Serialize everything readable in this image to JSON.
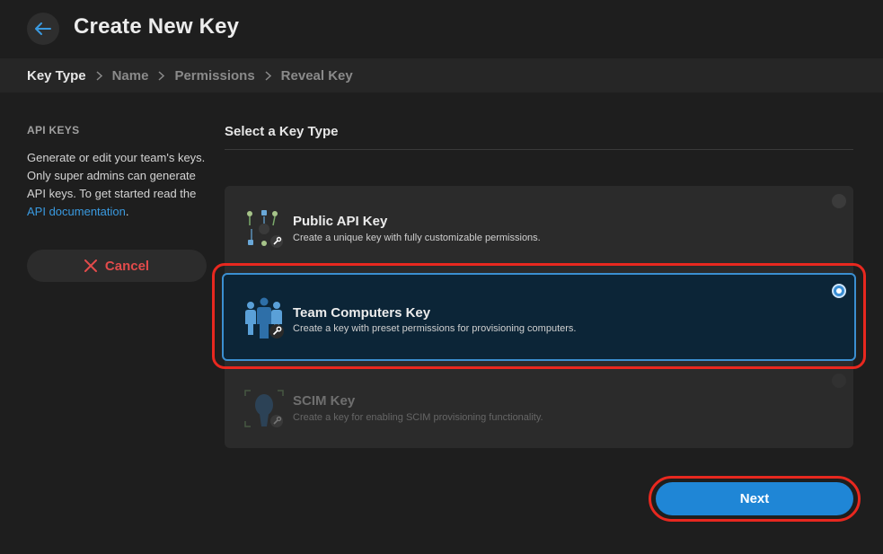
{
  "header": {
    "title": "Create New Key",
    "back_icon": "arrow-left-icon"
  },
  "breadcrumb": {
    "steps": [
      "Key Type",
      "Name",
      "Permissions",
      "Reveal Key"
    ],
    "active_index": 0
  },
  "sidebar": {
    "heading": "API KEYS",
    "text_before_link": "Generate or edit your team's keys. Only super admins can generate API keys. To get started read the ",
    "link_label": "API documentation",
    "text_after_link": ".",
    "cancel_label": "Cancel"
  },
  "main": {
    "section_title": "Select a Key Type",
    "options": [
      {
        "title": "Public API Key",
        "description": "Create a unique key with fully customizable permissions.",
        "icon": "api-network-key-icon",
        "selected": false,
        "disabled": false
      },
      {
        "title": "Team Computers Key",
        "description": "Create a key with preset permissions for provisioning computers.",
        "icon": "team-people-key-icon",
        "selected": true,
        "disabled": false
      },
      {
        "title": "SCIM Key",
        "description": "Create a key for enabling SCIM provisioning functionality.",
        "icon": "scim-user-key-icon",
        "selected": false,
        "disabled": true
      }
    ],
    "next_label": "Next"
  },
  "colors": {
    "accent": "#1f86d6",
    "cancel": "#e24b4b",
    "highlight": "#e8281f",
    "selected_bg": "#0c2537"
  }
}
